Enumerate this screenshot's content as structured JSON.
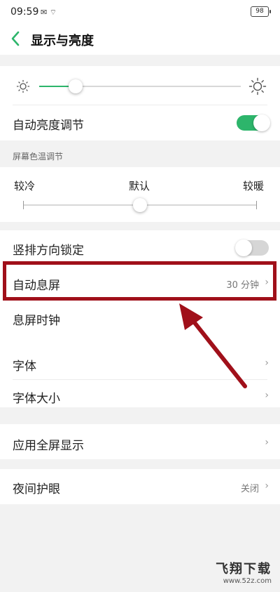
{
  "status_bar": {
    "time": "09:59",
    "icons": "✉ ⌔",
    "battery": "98"
  },
  "header": {
    "title": "显示与亮度"
  },
  "brightness": {
    "level": 0.18,
    "auto_label": "自动亮度调节",
    "auto_enabled": true
  },
  "color_temp": {
    "header": "屏幕色温调节",
    "cold_label": "较冷",
    "default_label": "默认",
    "warm_label": "较暖",
    "level": 0.5
  },
  "settings": {
    "orientation_lock_label": "竖排方向锁定",
    "orientation_lock_enabled": false,
    "auto_sleep_label": "自动息屏",
    "auto_sleep_value": "30 分钟",
    "sleep_clock_label": "息屏时钟",
    "font_label": "字体",
    "font_size_label": "字体大小",
    "fullscreen_apps_label": "应用全屏显示",
    "night_mode_label": "夜间护眼",
    "night_mode_value": "关闭"
  },
  "watermark": {
    "title": "飞翔下载",
    "url": "www.52z.com"
  },
  "colors": {
    "accent": "#2db56b",
    "highlight": "#a0101a"
  }
}
